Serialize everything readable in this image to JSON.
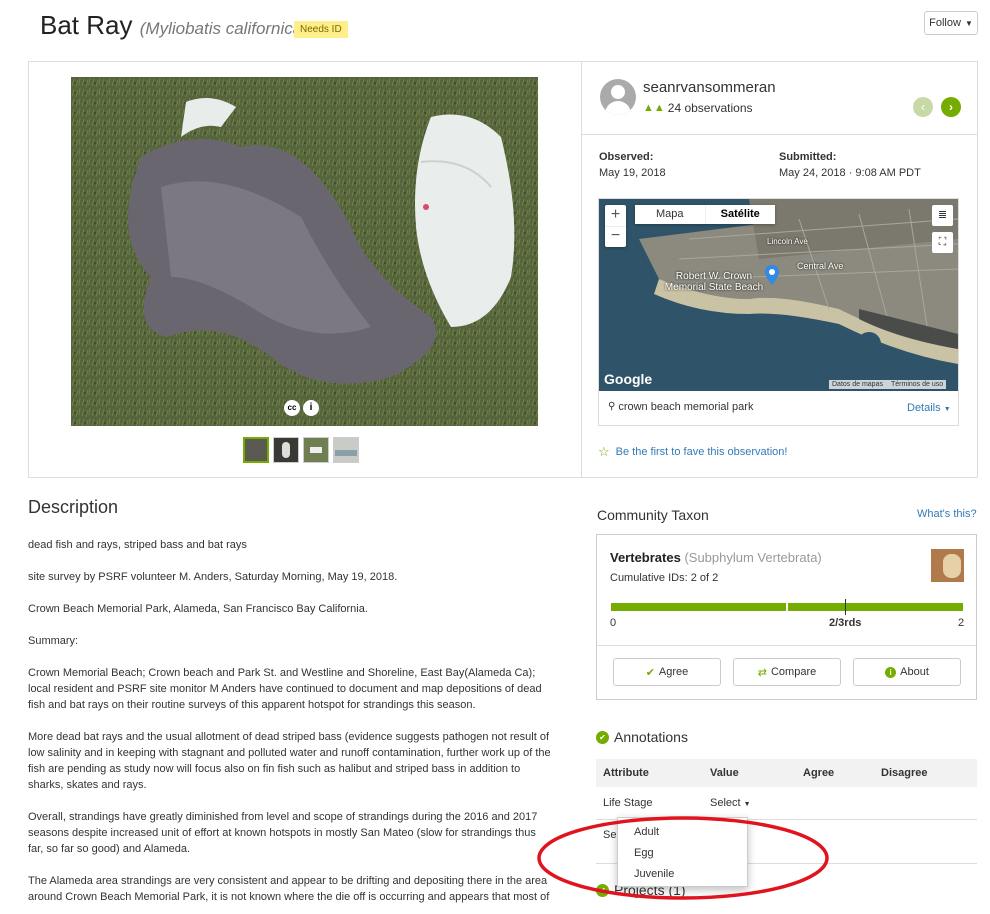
{
  "header": {
    "title": "Bat Ray",
    "scientific_name": "Myliobatis californica",
    "badge": "Needs ID",
    "follow_label": "Follow"
  },
  "observer": {
    "username": "seanrvansommeran",
    "observations": "24 observations"
  },
  "dates": {
    "observed_label": "Observed:",
    "observed_value": "May 19, 2018",
    "submitted_label": "Submitted:",
    "submitted_value": "May 24, 2018 · 9:08 AM PDT"
  },
  "map": {
    "tab_map": "Mapa",
    "tab_satellite": "Satélite",
    "label_place": "Robert W. Crown Memorial State Beach",
    "label_street": "Central Ave",
    "label_street2": "Lincoln Ave",
    "google": "Google",
    "footer_data": "Datos de mapas",
    "footer_terms": "Términos de uso",
    "location": "crown beach memorial park",
    "details": "Details"
  },
  "fave": "Be the first to fave this observation!",
  "description": {
    "heading": "Description",
    "paragraphs": [
      "dead fish and rays, striped bass and bat rays",
      "site survey by PSRF volunteer M. Anders, Saturday Morning, May 19, 2018.",
      "Crown Beach Memorial Park, Alameda, San Francisco Bay California.",
      "Summary:",
      "Crown Memorial Beach; Crown beach and Park St. and Westline and Shoreline, East Bay(Alameda Ca); local resident and PSRF site monitor M Anders have continued to document and map depositions of dead fish and bat rays on their routine surveys of this apparent hotspot for strandings this season.",
      "More dead bat rays and the usual allotment of dead striped bass (evidence suggests pathogen not result of low salinity and in keeping with stagnant and polluted water and runoff contamination, further work up of the fish are pending as study now will focus also on fin fish such as halibut and striped bass in addition to sharks, skates and rays.",
      "Overall, strandings have greatly diminished from level and scope of strandings during the 2016 and 2017 seasons despite increased unit of effort at known hotspots in mostly San Mateo (slow for strandings thus far, so far so good) and Alameda.",
      "The Alameda area strandings are very consistent and appear to be drifting and depositing there in the area around Crown Beach Memorial Park, it is not known where the die off is occurring and appears that most of"
    ]
  },
  "community": {
    "heading": "Community Taxon",
    "whats_this": "What's this?",
    "taxon_name": "Vertebrates",
    "taxon_sci": "(Subphylum Vertebrata)",
    "cumulative": "Cumulative IDs: 2 of 2",
    "scale_min": "0",
    "scale_mid": "2/3rds",
    "scale_max": "2",
    "progress_fraction": 1.0,
    "agree": "Agree",
    "compare": "Compare",
    "about": "About"
  },
  "annotations": {
    "heading": "Annotations",
    "col_attribute": "Attribute",
    "col_value": "Value",
    "col_agree": "Agree",
    "col_disagree": "Disagree",
    "row1_attr": "Life Stage",
    "row1_value": "Select",
    "row2_attr": "Se",
    "dropdown": [
      "Adult",
      "Egg",
      "Juvenile"
    ]
  },
  "projects": {
    "heading": "Projects (1)"
  },
  "colors": {
    "accent_green": "#74ac00",
    "link_blue": "#337ab7",
    "badge_yellow": "#ffef8a",
    "highlight_red": "#e0141e"
  }
}
